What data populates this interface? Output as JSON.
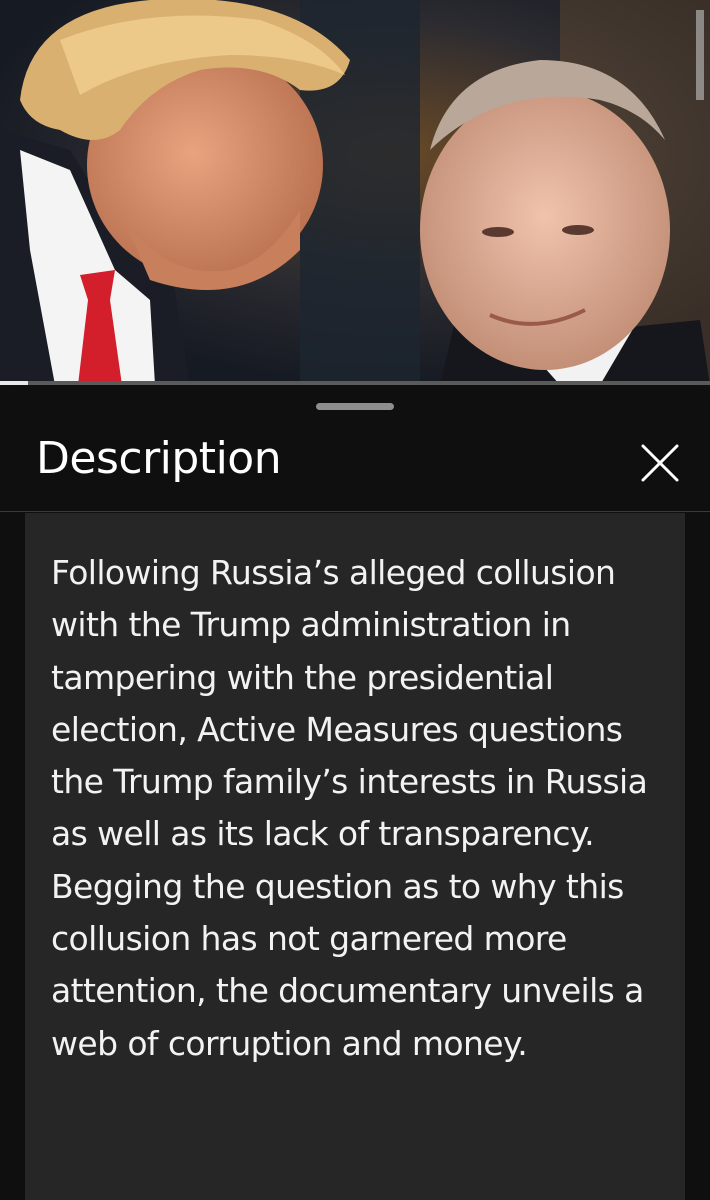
{
  "player": {
    "thumbnail_description": "Two men in suits leaning toward each other in conversation",
    "progress_fraction": 0.04,
    "colors": {
      "track": "#5a5a5a",
      "fill": "#e8e8e8"
    }
  },
  "description_panel": {
    "title": "Description",
    "close_icon": "close-icon",
    "body": "Following Russia’s alleged collusion with the Trump administration in tampering with the presidential election, Active Measures questions the Trump family’s interests in Russia as well as its lack of transparency. Begging the question as to why this collusion has not garnered more attention, the documentary unveils a web of corruption and money."
  }
}
